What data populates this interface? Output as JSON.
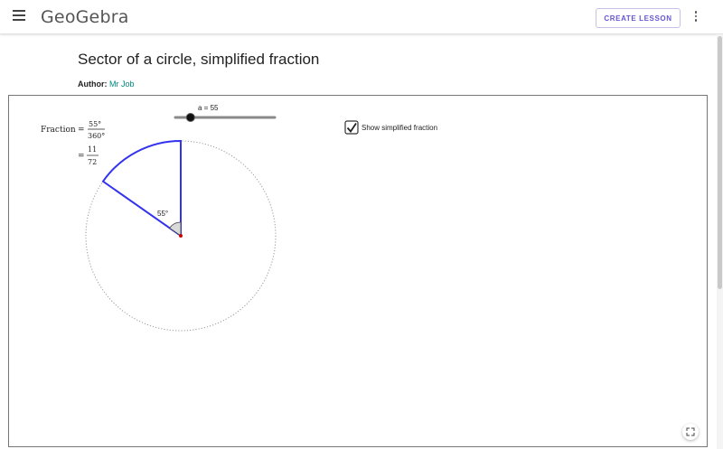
{
  "header": {
    "logo_text": "GeoGebra",
    "create_lesson_label": "CREATE LESSON"
  },
  "page": {
    "title": "Sector of a circle, simplified fraction",
    "author_label": "Author:",
    "author_name": "Mr Job"
  },
  "applet": {
    "slider_label": "a = 55",
    "slider_value": 55,
    "slider_min": 0,
    "slider_max": 360,
    "checkbox_label": "Show simplified fraction",
    "checkbox_checked": true,
    "fraction_label": "Fraction",
    "equals": "=",
    "fraction_num": "55°",
    "fraction_den": "360°",
    "simplified_num": "11",
    "simplified_den": "72",
    "angle_label": "55°",
    "colors": {
      "sector": "#3333ee",
      "center_point": "#cc0000",
      "circle_dotted": "#999999"
    }
  },
  "icons": {
    "menu": "menu-icon",
    "more": "more-vert-icon",
    "fullscreen": "fullscreen-icon",
    "checkbox": "check-icon"
  }
}
